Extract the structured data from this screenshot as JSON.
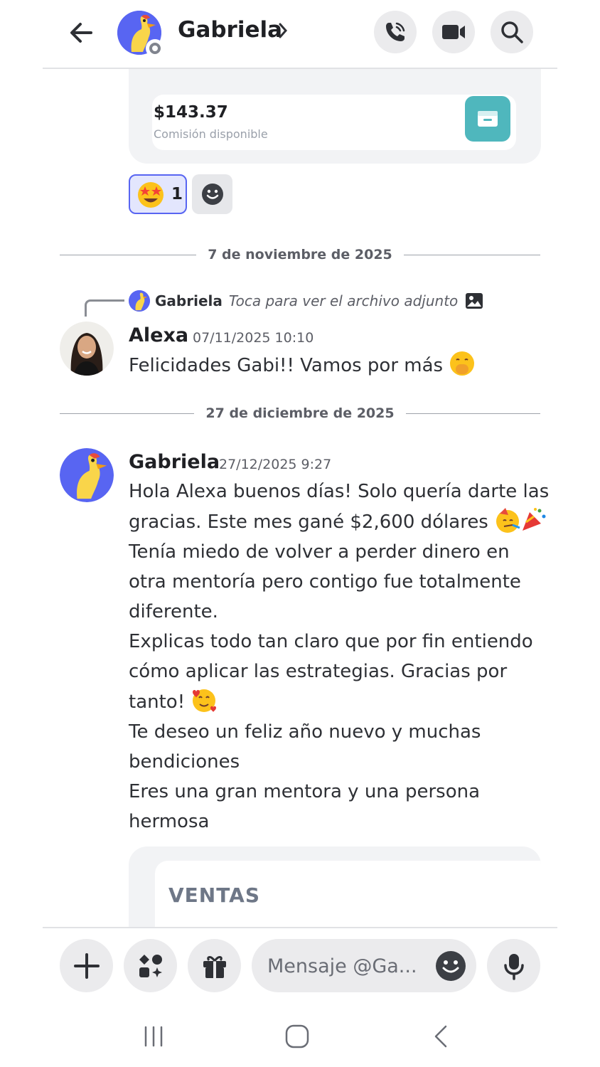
{
  "header": {
    "back_icon": "arrow-left-icon",
    "name": "Gabriela",
    "call_icon": "phone-call-icon",
    "video_icon": "video-camera-icon",
    "search_icon": "search-icon"
  },
  "embed_top": {
    "amount": "$143.37",
    "label": "Comisión disponible",
    "wallet_icon": "wallet-icon",
    "accent_color": "#4fb7bd"
  },
  "reactions": [
    {
      "emoji": "star-struck-emoji",
      "count": "1"
    }
  ],
  "add_reaction_icon": "add-reaction-icon",
  "date_dividers": [
    "7 de noviembre de 2025",
    "27 de diciembre de 2025"
  ],
  "messages": [
    {
      "reply": {
        "author": "Gabriela",
        "text": "Toca para ver el archivo adjunto",
        "icon": "image-icon"
      },
      "author": "Alexa",
      "timestamp": "07/11/2025 10:10",
      "lines": [
        "Felicidades Gabi!! Vamos por más"
      ],
      "emoji": "hand-over-mouth-emoji"
    },
    {
      "author": "Gabriela",
      "timestamp": "27/12/2025 9:27",
      "lines": [
        "Hola Alexa buenos días! Solo quería darte las",
        "gracias. Este mes gané $2,600 dólares",
        "Tenía miedo de volver a perder dinero en",
        "otra mentoría pero contigo fue totalmente",
        "diferente.",
        "Explicas todo tan claro que por fin entiendo",
        "cómo aplicar las estrategias. Gracias por",
        "tanto!",
        "Te deseo un feliz año nuevo y muchas",
        "bendiciones",
        "Eres una gran mentora y una persona",
        "hermosa"
      ],
      "emojis": [
        "partying-face-emoji",
        "party-popper-emoji",
        "smiling-face-with-hearts-emoji"
      ]
    }
  ],
  "ventas_embed": {
    "title": "VENTAS"
  },
  "composer": {
    "placeholder": "Mensaje @Ga...",
    "plus_icon": "plus-icon",
    "apps_icon": "apps-icon",
    "gift_icon": "gift-icon",
    "emoji_icon": "emoji-icon",
    "mic_icon": "microphone-icon"
  },
  "system_nav": [
    "recent-apps-icon",
    "home-icon",
    "back-icon"
  ],
  "colors": {
    "brand": "#5865f2",
    "reaction_bg": "#e3e6fd",
    "text_primary": "#1f2024",
    "text_muted": "#5c5e66"
  }
}
